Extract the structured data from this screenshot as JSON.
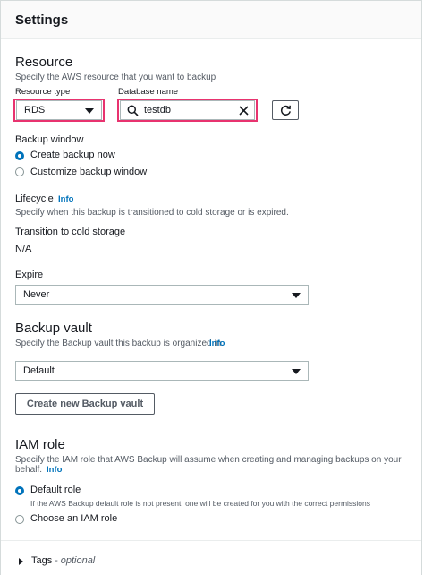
{
  "header": {
    "title": "Settings"
  },
  "resource": {
    "title": "Resource",
    "description": "Specify the AWS resource that you want to backup",
    "type_label": "Resource type",
    "type_value": "RDS",
    "db_label": "Database name",
    "db_value": "testdb"
  },
  "backup_window": {
    "label": "Backup window",
    "options": [
      "Create backup now",
      "Customize backup window"
    ],
    "selected": "Create backup now"
  },
  "lifecycle": {
    "label": "Lifecycle",
    "info": "Info",
    "description": "Specify when this backup is transitioned to cold storage or is expired.",
    "transition_label": "Transition to cold storage",
    "transition_value": "N/A",
    "expire_label": "Expire",
    "expire_value": "Never"
  },
  "backup_vault": {
    "title": "Backup vault",
    "description": "Specify the Backup vault this backup is organized in.",
    "info": "Info",
    "value": "Default",
    "create_button": "Create new Backup vault"
  },
  "iam_role": {
    "title": "IAM role",
    "description_line1": "Specify the IAM role that AWS Backup will assume when creating and managing backups on your",
    "description_line2": "behalf.",
    "info": "Info",
    "option_default": "Default role",
    "option_default_desc": "If the AWS Backup default role is not present, one will be created for you with the correct permissions",
    "option_choose": "Choose an IAM role"
  },
  "tags": {
    "label": "Tags",
    "optional": "- optional"
  }
}
